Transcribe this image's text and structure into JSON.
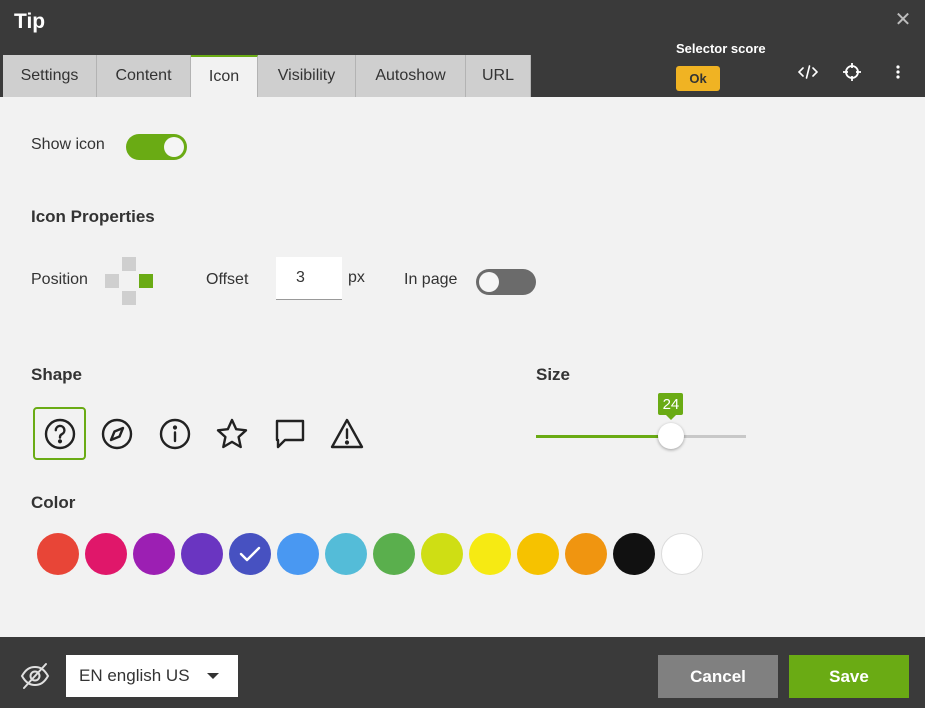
{
  "window": {
    "title": "Tip",
    "close_icon": "close-icon"
  },
  "tabs": [
    {
      "label": "Settings",
      "active": false
    },
    {
      "label": "Content",
      "active": false
    },
    {
      "label": "Icon",
      "active": true
    },
    {
      "label": "Visibility",
      "active": false
    },
    {
      "label": "Autoshow",
      "active": false
    },
    {
      "label": "URL",
      "active": false
    }
  ],
  "selector_score": {
    "label": "Selector score",
    "value": "Ok",
    "color": "#f0b323"
  },
  "header_icons": [
    "code-icon",
    "crosshair-icon",
    "more-vert-icon"
  ],
  "show_icon": {
    "label": "Show icon",
    "enabled": true
  },
  "icon_properties": {
    "heading": "Icon Properties",
    "position_label": "Position",
    "position_selected": "right",
    "offset_label": "Offset",
    "offset_value": "3",
    "offset_unit": "px",
    "in_page_label": "In page",
    "in_page_enabled": false
  },
  "shape": {
    "heading": "Shape",
    "options": [
      "question-circle-icon",
      "compass-icon",
      "info-circle-icon",
      "star-icon",
      "chat-bubble-icon",
      "warning-triangle-icon"
    ],
    "selected": "question-circle-icon"
  },
  "size": {
    "heading": "Size",
    "value": "24",
    "fraction": 0.645
  },
  "color": {
    "heading": "Color",
    "swatches": [
      "#e84537",
      "#e0176a",
      "#9c1fb3",
      "#6a35c1",
      "#4751c1",
      "#4998f2",
      "#54bcd8",
      "#5aaf4d",
      "#cfde14",
      "#f6ea13",
      "#f6c200",
      "#f09510",
      "#111111",
      "#ffffff"
    ],
    "selected_index": 4
  },
  "footer": {
    "visibility_icon": "eye-slash-icon",
    "language": "EN english US",
    "cancel_label": "Cancel",
    "save_label": "Save"
  },
  "accent_color": "#6aab14"
}
